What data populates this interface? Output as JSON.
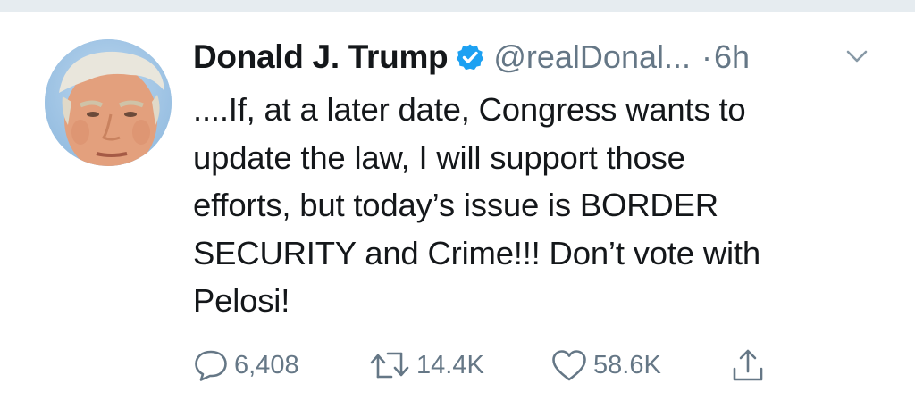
{
  "tweet": {
    "display_name": "Donald J. Trump",
    "handle": "@realDonal...",
    "separator": "·",
    "time": "6h",
    "lines": [
      "....If, at a later date, Congress wants to",
      "update the law, I will support those",
      "efforts, but today’s issue is BORDER",
      "SECURITY and Crime!!! Don’t vote with",
      "Pelosi!"
    ]
  },
  "actions": {
    "replies": "6,408",
    "retweets": "14.4K",
    "likes": "58.6K"
  },
  "icons": {
    "verified": "verified-badge-icon",
    "caret": "chevron-down-icon",
    "reply": "reply-icon",
    "retweet": "retweet-icon",
    "like": "heart-icon",
    "share": "share-icon"
  },
  "colors": {
    "text": "#14171a",
    "secondary": "#657786",
    "accent": "#1da1f2",
    "divider": "#e6ecf0"
  }
}
